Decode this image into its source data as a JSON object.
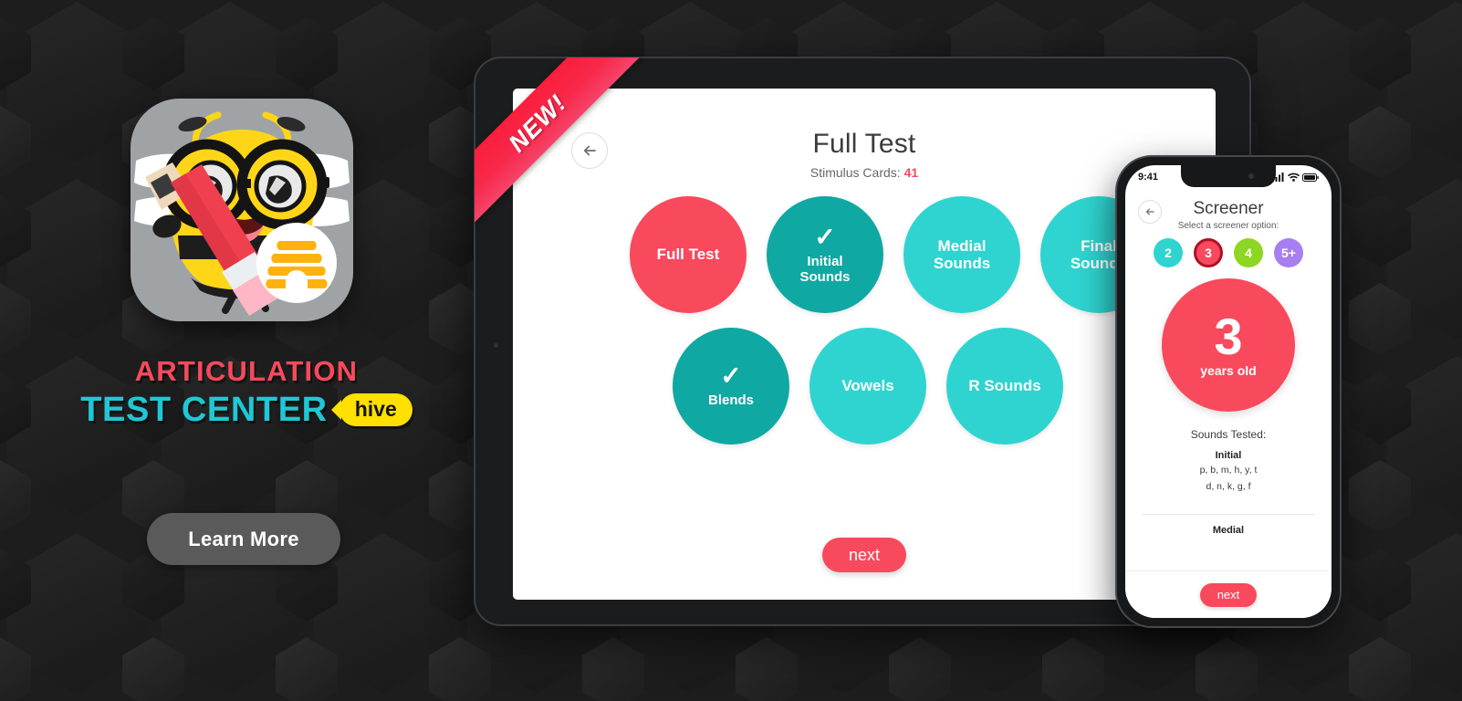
{
  "theme": {
    "red": "#f9495c",
    "teal_dark": "#0fa8a3",
    "teal_light": "#2fd4d0",
    "yellow": "#ffe000",
    "green": "#8ed624",
    "purple": "#a87ff0",
    "bg_dark": "#2a2a2a"
  },
  "left": {
    "app_icon_name": "articulation-test-center-bee-icon",
    "brand_line1": "ARTICULATION",
    "brand_line2": "TEST CENTER",
    "brand_badge": "hive",
    "cta_label": "Learn More"
  },
  "ribbon": {
    "label": "NEW!"
  },
  "tablet": {
    "back_icon": "arrow-left-icon",
    "title": "Full Test",
    "subtitle_label": "Stimulus Cards:",
    "subtitle_value": "41",
    "next_label": "next",
    "bubbles_row1": [
      {
        "label": "Full Test",
        "color": "#f9495c",
        "checked": false
      },
      {
        "label": "Initial\nSounds",
        "color": "#0fa8a3",
        "checked": true
      },
      {
        "label": "Medial\nSounds",
        "color": "#2fd4d0",
        "checked": false
      },
      {
        "label": "Final\nSounds",
        "color": "#2fd4d0",
        "checked": false
      }
    ],
    "bubbles_row2": [
      {
        "label": "Blends",
        "color": "#0fa8a3",
        "checked": true
      },
      {
        "label": "Vowels",
        "color": "#2fd4d0",
        "checked": false
      },
      {
        "label": "R Sounds",
        "color": "#2fd4d0",
        "checked": false
      }
    ]
  },
  "phone": {
    "status_time": "9:41",
    "status_icons": [
      "cellular-signal-icon",
      "wifi-icon",
      "battery-icon"
    ],
    "back_icon": "arrow-left-icon",
    "title": "Screener",
    "subtitle": "Select a screener option:",
    "age_options": [
      {
        "label": "2",
        "color": "#2fd4d0",
        "selected": false
      },
      {
        "label": "3",
        "color": "#f9495c",
        "selected": true
      },
      {
        "label": "4",
        "color": "#8ed624",
        "selected": false
      },
      {
        "label": "5+",
        "color": "#a87ff0",
        "selected": false
      }
    ],
    "selected_age_number": "3",
    "selected_age_unit": "years old",
    "sounds_title": "Sounds Tested:",
    "sections": [
      {
        "name": "Initial",
        "rows": [
          "p,  b,  m,  h,  y,  t",
          "d,  n,  k,  g,  f"
        ]
      },
      {
        "name": "Medial",
        "rows": []
      }
    ],
    "next_label": "next"
  }
}
